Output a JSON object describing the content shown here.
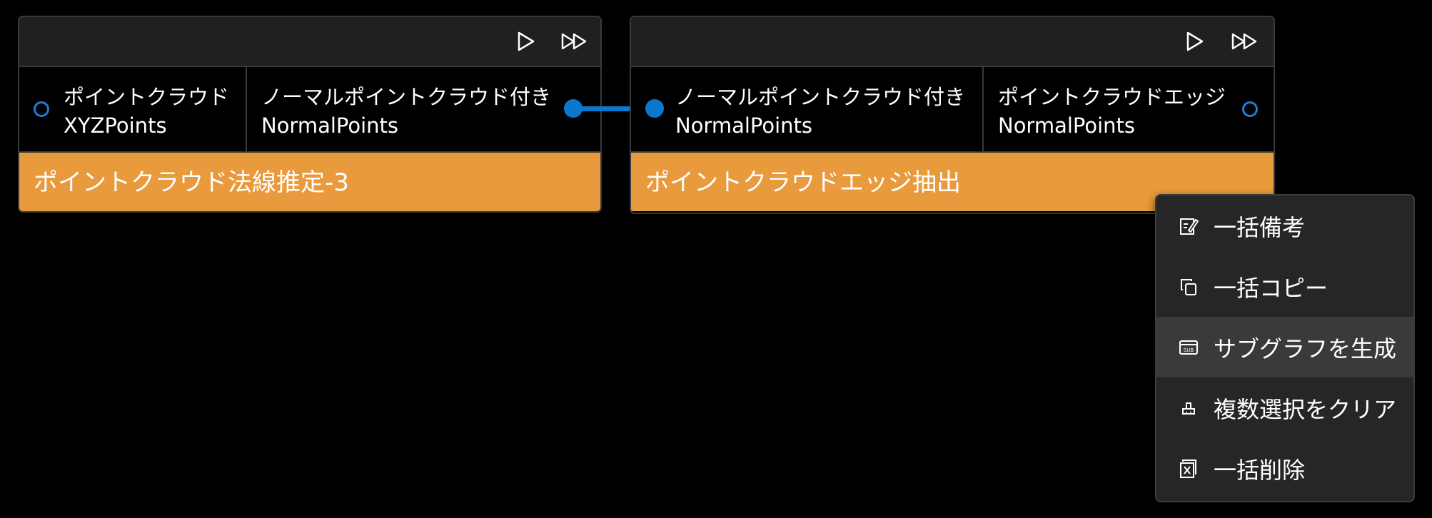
{
  "colors": {
    "background": "#000000",
    "node_header": "#202020",
    "node_border": "#3a3a3a",
    "node_footer": "#e89a3c",
    "port": "#0b78d0",
    "menu_bg": "#262626",
    "menu_hover": "#3a3a3a"
  },
  "nodes": [
    {
      "title": "ポイントクラウド法線推定-3",
      "inputs": [
        {
          "name": "ポイントクラウド",
          "type": "XYZPoints"
        }
      ],
      "outputs": [
        {
          "name": "ノーマルポイントクラウド付き",
          "type": "NormalPoints"
        }
      ]
    },
    {
      "title": "ポイントクラウドエッジ抽出",
      "inputs": [
        {
          "name": "ノーマルポイントクラウド付き",
          "type": "NormalPoints"
        }
      ],
      "outputs": [
        {
          "name": "ポイントクラウドエッジ",
          "type": "NormalPoints"
        }
      ]
    }
  ],
  "header_buttons": {
    "run": "play-icon",
    "run_all": "fast-forward-icon"
  },
  "context_menu": {
    "items": [
      {
        "label": "一括備考",
        "icon": "note-edit-icon"
      },
      {
        "label": "一括コピー",
        "icon": "copy-icon"
      },
      {
        "label": "サブグラフを生成",
        "icon": "subgraph-icon",
        "highlighted": true
      },
      {
        "label": "複数選択をクリア",
        "icon": "eraser-icon"
      },
      {
        "label": "一括削除",
        "icon": "delete-icon"
      }
    ]
  }
}
